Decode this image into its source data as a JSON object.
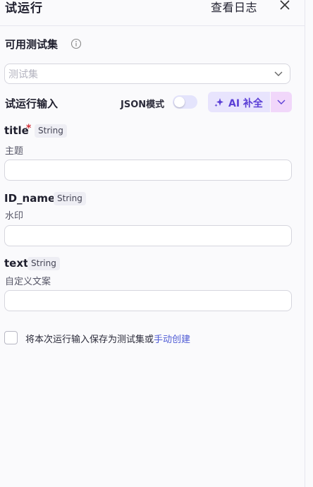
{
  "header": {
    "title": "试运行",
    "view_log": "查看日志"
  },
  "testset": {
    "label": "可用测试集",
    "placeholder": "测试集"
  },
  "input_section": {
    "label": "试运行输入",
    "json_mode_label": "JSON模式",
    "ai_label": "AI 补全"
  },
  "fields": [
    {
      "name": "title",
      "type": "String",
      "required": true,
      "description": "主题",
      "value": ""
    },
    {
      "name": "ID_name",
      "type": "String",
      "required": false,
      "description": "水印",
      "value": ""
    },
    {
      "name": "text",
      "type": "String",
      "required": false,
      "description": "自定义文案",
      "value": ""
    }
  ],
  "save": {
    "text": "将本次运行输入保存为测试集或",
    "link": "手动创建"
  },
  "colors": {
    "accent": "#5b3fd6",
    "link": "#4f5bd5",
    "required": "#d0343c"
  }
}
